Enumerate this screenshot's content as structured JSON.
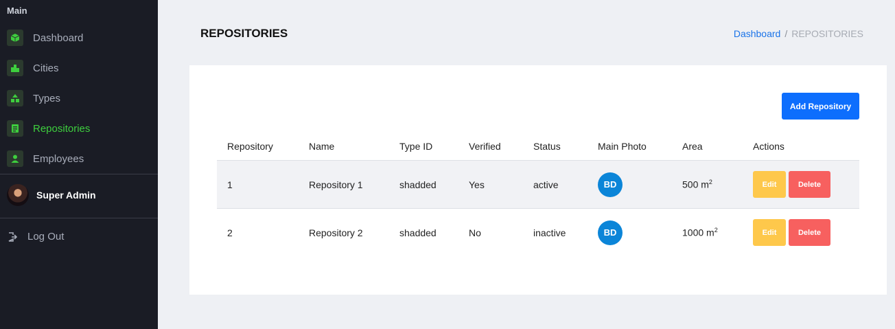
{
  "sidebar": {
    "heading": "Main",
    "items": [
      {
        "label": "Dashboard",
        "icon": "cube-icon",
        "active": false
      },
      {
        "label": "Cities",
        "icon": "buildings-icon",
        "active": false
      },
      {
        "label": "Types",
        "icon": "shapes-icon",
        "active": false
      },
      {
        "label": "Repositories",
        "icon": "clipboard-icon",
        "active": true
      },
      {
        "label": "Employees",
        "icon": "user-icon",
        "active": false
      }
    ],
    "user": {
      "name": "Super Admin"
    },
    "logout_label": "Log Out"
  },
  "header": {
    "title": "REPOSITORIES",
    "breadcrumb": {
      "link": "Dashboard",
      "separator": "/",
      "current": "REPOSITORIES"
    }
  },
  "card": {
    "add_button": "Add Repository",
    "columns": [
      "Repository",
      "Name",
      "Type ID",
      "Verified",
      "Status",
      "Main Photo",
      "Area",
      "Actions"
    ],
    "rows": [
      {
        "id": "1",
        "name": "Repository 1",
        "type_id": "shadded",
        "verified": "Yes",
        "status": "active",
        "photo": "BD",
        "area": "500 m",
        "area_unit_sup": "2",
        "edit": "Edit",
        "delete": "Delete"
      },
      {
        "id": "2",
        "name": "Repository 2",
        "type_id": "shadded",
        "verified": "No",
        "status": "inactive",
        "photo": "BD",
        "area": "1000 m",
        "area_unit_sup": "2",
        "edit": "Edit",
        "delete": "Delete"
      }
    ]
  },
  "colors": {
    "sidebar_bg": "#1a1c25",
    "active_green": "#3ecf3e",
    "primary_blue": "#0d6efd",
    "edit_yellow": "#fec84b",
    "delete_red": "#f7605f",
    "badge_blue": "#0b85d8"
  }
}
